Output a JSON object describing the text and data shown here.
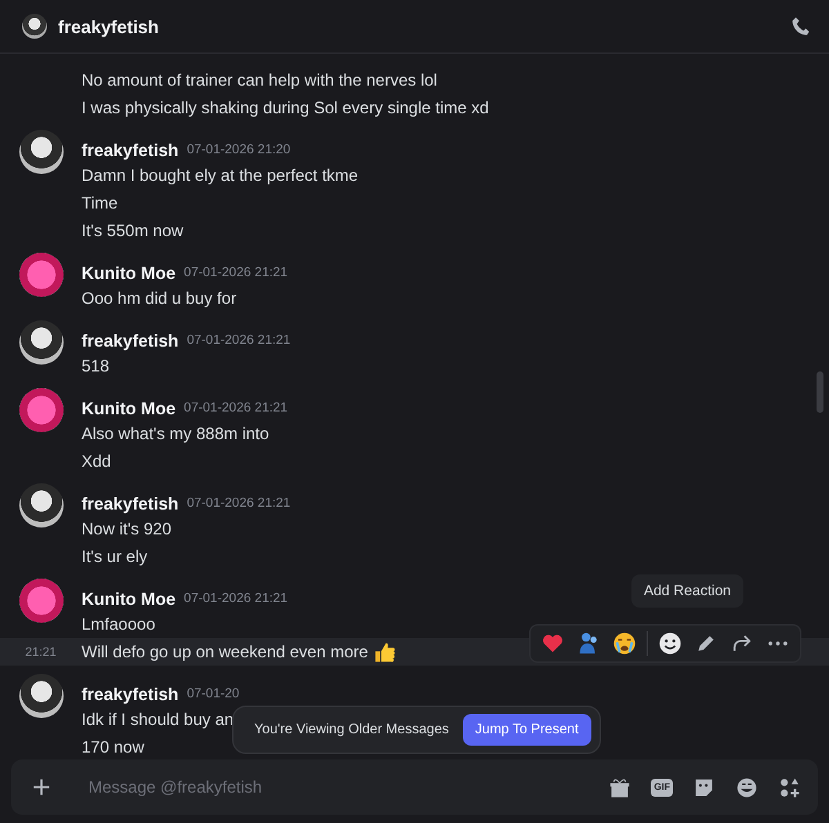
{
  "header": {
    "title": "freakyfetish"
  },
  "groups": [
    {
      "lines": [
        {
          "text": "No amount of trainer can help with the nerves lol",
          "hovered": false,
          "has_emoji": false
        },
        {
          "text": "I was physically shaking during Sol every single time xd",
          "hovered": false,
          "has_emoji": false
        }
      ]
    },
    {
      "author": "freakyfetish",
      "timestamp": "07-01-2026 21:20",
      "kind": "dark",
      "lines": [
        {
          "text": "Damn I bought ely at the perfect tkme",
          "hovered": false,
          "has_emoji": false
        },
        {
          "text": "Time",
          "hovered": false,
          "has_emoji": false
        },
        {
          "text": "It's 550m now",
          "hovered": false,
          "has_emoji": false
        }
      ]
    },
    {
      "author": "Kunito Moe",
      "timestamp": "07-01-2026 21:21",
      "kind": "pink",
      "lines": [
        {
          "text": "Ooo hm did u buy for",
          "hovered": false,
          "has_emoji": false
        }
      ]
    },
    {
      "author": "freakyfetish",
      "timestamp": "07-01-2026 21:21",
      "kind": "dark",
      "lines": [
        {
          "text": "518",
          "hovered": false,
          "has_emoji": false
        }
      ]
    },
    {
      "author": "Kunito Moe",
      "timestamp": "07-01-2026 21:21",
      "kind": "pink",
      "lines": [
        {
          "text": "Also what's my 888m into",
          "hovered": false,
          "has_emoji": false
        },
        {
          "text": "Xdd",
          "hovered": false,
          "has_emoji": false
        }
      ]
    },
    {
      "author": "freakyfetish",
      "timestamp": "07-01-2026 21:21",
      "kind": "dark",
      "lines": [
        {
          "text": "Now it's 920",
          "hovered": false,
          "has_emoji": false
        },
        {
          "text": "It's ur ely",
          "hovered": false,
          "has_emoji": false
        }
      ]
    },
    {
      "author": "Kunito Moe",
      "timestamp": "07-01-2026 21:21",
      "kind": "pink",
      "lines": [
        {
          "text": "Lmfaoooo",
          "hovered": false,
          "has_emoji": false
        },
        {
          "text": "Will defo go up on weekend even more",
          "hovered": true,
          "time": "21:21",
          "has_emoji": true
        }
      ]
    },
    {
      "author": "freakyfetish",
      "timestamp": "07-01-20",
      "kind": "dark",
      "lines": [
        {
          "text": "Idk if I should buy an",
          "hovered": false,
          "has_emoji": false
        },
        {
          "text": "170 now",
          "hovered": false,
          "has_emoji": false
        }
      ]
    }
  ],
  "tooltip": "Add Reaction",
  "older_banner": {
    "text": "You're Viewing Older Messages",
    "button": "Jump To Present"
  },
  "composer": {
    "placeholder": "Message @freakyfetish",
    "gif_label": "GIF"
  }
}
